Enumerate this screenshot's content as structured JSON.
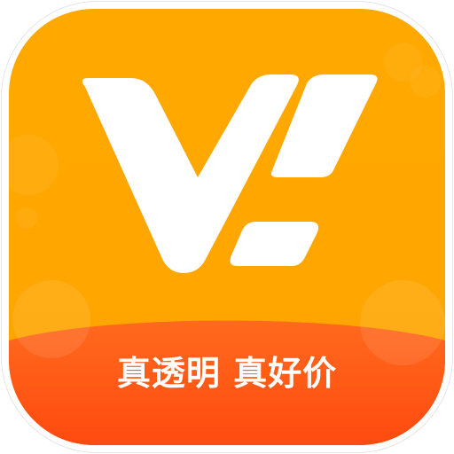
{
  "app_icon": {
    "slogan": "真透明 真好价",
    "colors": {
      "background": "#ffa800",
      "wave": "#ff5a16",
      "mark": "#ffffff"
    },
    "icon_name": "stylized-v-with-exclamation"
  }
}
